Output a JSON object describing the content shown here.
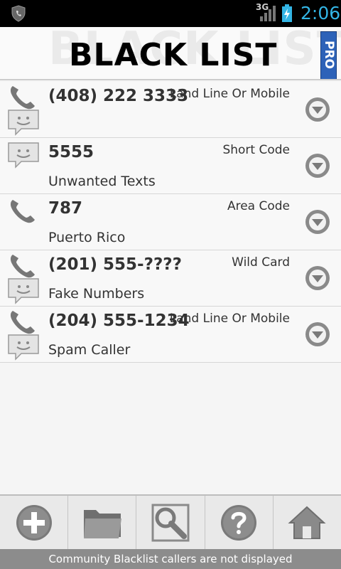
{
  "status_bar": {
    "network": "3G",
    "time": "2:06"
  },
  "header": {
    "title": "BLACK LIST",
    "badge": "PRO"
  },
  "entries": [
    {
      "number": "(408) 222 3333",
      "type": "Land Line Or Mobile",
      "description": "",
      "blocks": "phone+sms"
    },
    {
      "number": "5555",
      "type": "Short Code",
      "description": "Unwanted Texts",
      "blocks": "sms"
    },
    {
      "number": "787",
      "type": "Area Code",
      "description": "Puerto Rico",
      "blocks": "phone"
    },
    {
      "number": "(201) 555-????",
      "type": "Wild Card",
      "description": "Fake Numbers",
      "blocks": "phone+sms"
    },
    {
      "number": "(204) 555-1234",
      "type": "Land Line Or Mobile",
      "description": "Spam Caller",
      "blocks": "phone+sms"
    }
  ],
  "toolbar": {
    "buttons": [
      "plus-icon",
      "folder-icon",
      "search-settings-icon",
      "help-icon",
      "home-icon"
    ]
  },
  "footer": {
    "text": "Community Blacklist callers are not displayed"
  },
  "colors": {
    "accent": "#33b5e5",
    "pro_badge": "#2d62b8",
    "footer_bg": "#8c8c8c"
  }
}
